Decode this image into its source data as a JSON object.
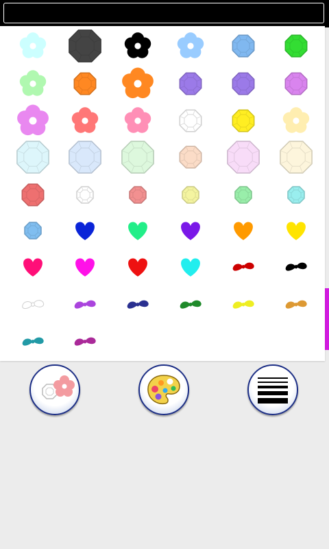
{
  "status_bar": {
    "color": "#000000"
  },
  "stickers": [
    {
      "shape": "flower",
      "color": "#ccffff",
      "size": 42
    },
    {
      "shape": "octagon",
      "color": "#444444",
      "size": 52
    },
    {
      "shape": "flower",
      "color": "#000000",
      "size": 42
    },
    {
      "shape": "flower",
      "color": "#99ccff",
      "size": 42
    },
    {
      "shape": "octagon",
      "color": "#80b8f0",
      "size": 36
    },
    {
      "shape": "octagon",
      "color": "#33dd33",
      "size": 36
    },
    {
      "shape": "flower",
      "color": "#b0f8b0",
      "size": 42
    },
    {
      "shape": "octagon",
      "color": "#ff8822",
      "size": 36
    },
    {
      "shape": "flower",
      "color": "#ff8822",
      "size": 50
    },
    {
      "shape": "octagon",
      "color": "#9b7ae8",
      "size": 36
    },
    {
      "shape": "octagon",
      "color": "#9b7ae8",
      "size": 36
    },
    {
      "shape": "octagon",
      "color": "#d984ee",
      "size": 36
    },
    {
      "shape": "flower",
      "color": "#e988f0",
      "size": 50
    },
    {
      "shape": "flower",
      "color": "#ff7777",
      "size": 42
    },
    {
      "shape": "flower",
      "color": "#ff8fb6",
      "size": 42
    },
    {
      "shape": "octagon",
      "color": "#ffffff",
      "size": 36
    },
    {
      "shape": "octagon",
      "color": "#ffee22",
      "size": 36
    },
    {
      "shape": "flower",
      "color": "#ffeeb0",
      "size": 42
    },
    {
      "shape": "octagon",
      "color": "#ddf6fb",
      "size": 52
    },
    {
      "shape": "octagon",
      "color": "#d9e8fb",
      "size": 52
    },
    {
      "shape": "octagon",
      "color": "#ddf8dd",
      "size": 52
    },
    {
      "shape": "octagon",
      "color": "#fbdcc7",
      "size": 36
    },
    {
      "shape": "octagon",
      "color": "#f8dcf8",
      "size": 52
    },
    {
      "shape": "octagon",
      "color": "#fdf5dc",
      "size": 52
    },
    {
      "shape": "octagon",
      "color": "#ee7070",
      "size": 36
    },
    {
      "shape": "octagon",
      "color": "#ffffff",
      "size": 28
    },
    {
      "shape": "octagon",
      "color": "#f29090",
      "size": 28
    },
    {
      "shape": "octagon",
      "color": "#f4f4a0",
      "size": 28
    },
    {
      "shape": "octagon",
      "color": "#99eeaa",
      "size": 28
    },
    {
      "shape": "octagon",
      "color": "#99eeee",
      "size": 28
    },
    {
      "shape": "octagon",
      "color": "#80bef0",
      "size": 28
    },
    {
      "shape": "heart",
      "color": "#0a24d8",
      "size": 36
    },
    {
      "shape": "heart",
      "color": "#22ee88",
      "size": 36
    },
    {
      "shape": "heart",
      "color": "#7a18e8",
      "size": 36
    },
    {
      "shape": "heart",
      "color": "#ff9a00",
      "size": 36
    },
    {
      "shape": "heart",
      "color": "#ffe400",
      "size": 36
    },
    {
      "shape": "heart",
      "color": "#ff0f78",
      "size": 36
    },
    {
      "shape": "heart",
      "color": "#ff11e8",
      "size": 36
    },
    {
      "shape": "heart",
      "color": "#ee1111",
      "size": 36
    },
    {
      "shape": "heart",
      "color": "#22eeee",
      "size": 36
    },
    {
      "shape": "bow",
      "color": "#cc0000",
      "size": 34
    },
    {
      "shape": "bow",
      "color": "#000000",
      "size": 34
    },
    {
      "shape": "bow",
      "color": "#ffffff",
      "size": 34
    },
    {
      "shape": "bow",
      "color": "#aa44dd",
      "size": 34
    },
    {
      "shape": "bow",
      "color": "#2a3090",
      "size": 34
    },
    {
      "shape": "bow",
      "color": "#1f8a2a",
      "size": 34
    },
    {
      "shape": "bow",
      "color": "#eeee22",
      "size": 34
    },
    {
      "shape": "bow",
      "color": "#dd9933",
      "size": 34
    },
    {
      "shape": "bow",
      "color": "#229aa6",
      "size": 34
    },
    {
      "shape": "bow",
      "color": "#aa2a99",
      "size": 34
    }
  ],
  "toolbar": {
    "buttons": [
      {
        "name": "stamp-picker-button",
        "icon": "flower-gem-icon"
      },
      {
        "name": "color-palette-button",
        "icon": "palette-icon"
      },
      {
        "name": "menu-button",
        "icon": "lines-icon"
      }
    ]
  }
}
